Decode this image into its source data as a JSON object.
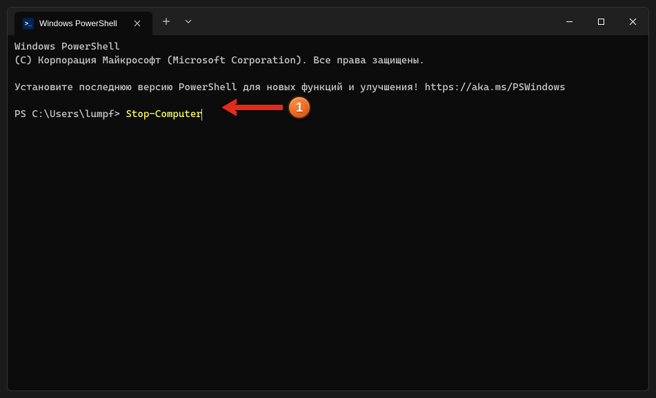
{
  "titlebar": {
    "tab_title": "Windows PowerShell",
    "tab_icon_label": ">_"
  },
  "terminal": {
    "header_line1": "Windows PowerShell",
    "header_line2": "(C) Корпорация Майкрософт (Microsoft Corporation). Все права защищены.",
    "info_line": "Установите последнюю версию PowerShell для новых функций и улучшения! https://aka.ms/PSWindows",
    "prompt": "PS C:\\Users\\lumpf> ",
    "command": "Stop-Computer"
  },
  "annotation": {
    "badge_number": "1"
  }
}
